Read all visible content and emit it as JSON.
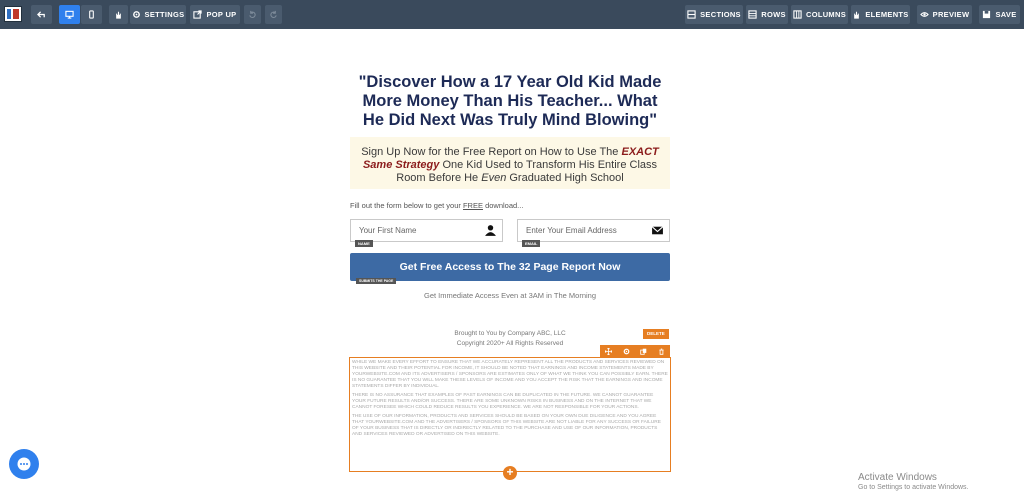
{
  "toolbar": {
    "settings": "SETTINGS",
    "popup": "POP UP",
    "sections": "SECTIONS",
    "rows": "ROWS",
    "columns": "COLUMNS",
    "elements": "ELEMENTS",
    "preview": "PREVIEW",
    "save": "SAVE",
    "accent": "#2f80ed"
  },
  "page": {
    "headline": "\"Discover How a 17 Year Old Kid Made More Money Than His Teacher... What He Did Next Was Truly Mind Blowing\"",
    "sub_1": "Sign Up Now for the Free Report on How to Use The ",
    "sub_em": "EXACT Same Strategy",
    "sub_2": " One Kid Used to Transform His Entire Class Room Before He ",
    "sub_it": "Even",
    "sub_3": " Graduated High School",
    "form_label_1": "Fill out the form below to get your ",
    "form_label_free": "FREE",
    "form_label_2": " download...",
    "name_placeholder": "Your First Name",
    "name_tag": "NAME",
    "email_placeholder": "Enter Your Email Address",
    "email_tag": "EMAIL",
    "cta": "Get Free Access to The 32 Page Report Now",
    "cta_tag": "SUBMITS THE PAGE",
    "note": "Get Immediate Access Even at 3AM in The Morning",
    "brought_1": "Brought to You by Company ABC, LLC",
    "brought_2": "Copyright 2020+ All Rights Reserved",
    "delete_tip": "DELETE",
    "disclaimer": [
      "While we make every effort to ensure that we accurately represent all the products and services reviewed on this website and their potential for income, it should be noted that earnings and income statements made by yourwebsite.com and its advertisers / sponsors are estimates only of what we think you can possibly earn. There is no guarantee that you will make these levels of income and you accept the risk that the earnings and income statements differ by individual.",
      "There is no assurance that examples of past earnings can be duplicated in the future. We cannot guarantee your future results and/or success. There are some unknown risks in business and on the internet that we cannot foresee which could reduce results you experience. We are not responsible for your actions.",
      "The use of our information, products and services should be based on your own due diligence and you agree that yourwebsite.com and the advertisers / sponsors of this website are not liable for any success or failure of your business that is directly or indirectly related to the purchase and use of our information, products and services reviewed or advertised on this website."
    ]
  },
  "watermark": {
    "title": "Activate Windows",
    "sub": "Go to Settings to activate Windows."
  }
}
